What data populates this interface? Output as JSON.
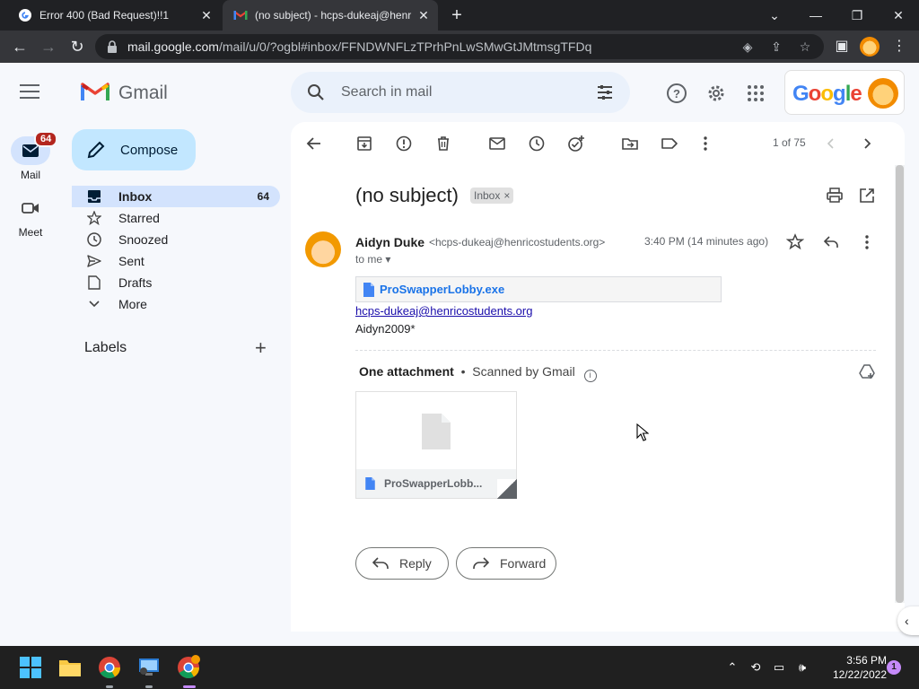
{
  "browser": {
    "tabs": [
      {
        "title": "Error 400 (Bad Request)!!1",
        "favicon": "google-g-icon"
      },
      {
        "title": "(no subject) - hcps-dukeaj@henr",
        "favicon": "gmail-icon",
        "active": true
      }
    ],
    "url_host": "mail.google.com",
    "url_path": "/mail/u/0/?ogbl#inbox/FFNDWNFLzTPrhPnLwSMwGtJMtmsgTFDq"
  },
  "header": {
    "app_name": "Gmail",
    "search_placeholder": "Search in mail",
    "account_logo_text": "Google"
  },
  "rail": {
    "mail_label": "Mail",
    "mail_badge": "64",
    "meet_label": "Meet"
  },
  "sidebar": {
    "compose_label": "Compose",
    "items": [
      {
        "label": "Inbox",
        "count": "64",
        "icon": "inbox-icon",
        "active": true
      },
      {
        "label": "Starred",
        "icon": "star-icon"
      },
      {
        "label": "Snoozed",
        "icon": "clock-icon"
      },
      {
        "label": "Sent",
        "icon": "send-icon"
      },
      {
        "label": "Drafts",
        "icon": "draft-icon"
      },
      {
        "label": "More",
        "icon": "chevron-down-icon"
      }
    ],
    "labels_heading": "Labels"
  },
  "message": {
    "pagination": "1 of 75",
    "subject": "(no subject)",
    "label_chip": "Inbox",
    "sender_name": "Aidyn Duke",
    "sender_email": "<hcps-dukeaj@henricostudents.org>",
    "time": "3:40 PM (14 minutes ago)",
    "recipient": "to me",
    "inline_attachment": "ProSwapperLobby.exe",
    "body_link": "hcps-dukeaj@henricostudents.org",
    "body_text": "Aidyn2009*",
    "attachments_heading": "One attachment",
    "scan_text": "Scanned by Gmail",
    "attachment_card_name": "ProSwapperLobb...",
    "reply_label": "Reply",
    "forward_label": "Forward"
  },
  "taskbar": {
    "time": "3:56 PM",
    "date": "12/22/2022",
    "notification_count": "1"
  },
  "colors": {
    "gmail_bg": "#f6f8fc",
    "compose": "#c2e7ff",
    "nav_active": "#d3e3fd",
    "badge": "#b3261e",
    "link": "#1a73e8"
  }
}
